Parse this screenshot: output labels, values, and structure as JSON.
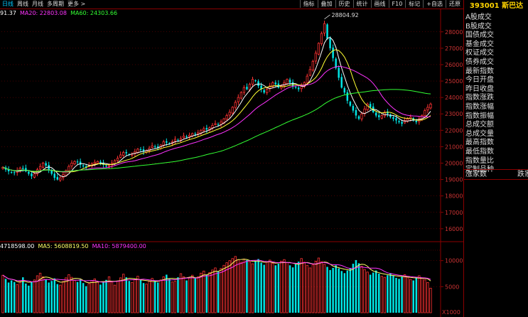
{
  "toolbar": {
    "tabs": [
      {
        "label": "日线",
        "active": true
      },
      {
        "label": "周线",
        "active": false
      },
      {
        "label": "月线",
        "active": false
      },
      {
        "label": "多周期",
        "active": false
      },
      {
        "label": "更多 >",
        "active": false
      }
    ],
    "buttons": [
      {
        "label": "指标",
        "icon": "indicator"
      },
      {
        "label": "叠加",
        "icon": "overlay"
      },
      {
        "label": "历史",
        "icon": "history"
      },
      {
        "label": "统计",
        "icon": "stats"
      },
      {
        "label": "画线",
        "icon": "draw-line"
      },
      {
        "label": "F10",
        "icon": "f10"
      },
      {
        "label": "标记",
        "icon": "mark"
      },
      {
        "label": "+自选",
        "icon": "add-watch"
      },
      {
        "label": "还原",
        "icon": "restore"
      }
    ]
  },
  "ma_legend": [
    {
      "text": "91.37",
      "color": "#ffffff"
    },
    {
      "text": "MA20: 22803.08",
      "color": "#ff33ff"
    },
    {
      "text": "MA60: 24303.66",
      "color": "#33ff33"
    }
  ],
  "volume_legend": [
    {
      "text": "4718598.00",
      "color": "#ffffff"
    },
    {
      "text": "MA5: 5608819.50",
      "color": "#ffff66"
    },
    {
      "text": "MA10: 5879400.00",
      "color": "#ff33ff"
    }
  ],
  "colors": {
    "up": "#ff3333",
    "down": "#00e5e5",
    "grid": "#8b0000",
    "axis_label": "#cc3333"
  },
  "right_panel": {
    "symbol": "393001 斯巴达",
    "menu": [
      "A股成交",
      "B股成交",
      "国债成交",
      "基金成交",
      "权证成交",
      "债券成交",
      "最新指数",
      "今日开盘",
      "昨日收盘",
      "指数涨跌",
      "指数涨幅",
      "指数振幅",
      "总成交额",
      "总成交量",
      "最高指数",
      "最低指数",
      "指数量比",
      "定制品种"
    ],
    "stats": [
      {
        "label": "涨家数"
      },
      {
        "label": "跌家"
      }
    ]
  },
  "chart_data": {
    "type": "candlestick",
    "price_axis": {
      "ticks": [
        28000,
        27000,
        26000,
        25000,
        24000,
        23000,
        22000,
        21000,
        20000,
        19000,
        18000,
        17000,
        16000
      ],
      "range": [
        15300,
        28900
      ]
    },
    "volume_axis": {
      "ticks": [
        10000,
        5000
      ],
      "unit_label": "X1000",
      "range": [
        0,
        12000
      ]
    },
    "peak_annotation": "28804.92",
    "closes": [
      19750,
      19600,
      19500,
      19450,
      19400,
      19550,
      19700,
      19650,
      19500,
      19350,
      19200,
      19350,
      19600,
      19800,
      20000,
      19850,
      19600,
      19350,
      19100,
      19000,
      19100,
      19300,
      19550,
      19800,
      20000,
      20100,
      20050,
      19900,
      19800,
      19750,
      19850,
      19950,
      20050,
      20100,
      20000,
      19900,
      19800,
      19850,
      20000,
      20150,
      20300,
      20500,
      20650,
      20600,
      20500,
      20550,
      20700,
      20850,
      20800,
      20700,
      20750,
      20900,
      21050,
      21000,
      20950,
      21100,
      21300,
      21250,
      21200,
      21300,
      21450,
      21400,
      21500,
      21650,
      21600,
      21700,
      21800,
      21750,
      21850,
      22000,
      22100,
      22050,
      22150,
      22300,
      22400,
      22350,
      22500,
      22700,
      22900,
      23100,
      23400,
      23700,
      24000,
      24300,
      24600,
      24500,
      24800,
      25100,
      25000,
      24700,
      24500,
      24300,
      24500,
      24700,
      24900,
      24800,
      24600,
      24700,
      24900,
      25100,
      24900,
      24700,
      24600,
      24500,
      24700,
      24900,
      25300,
      25700,
      26200,
      26700,
      27300,
      27900,
      28500,
      27600,
      27000,
      26400,
      25800,
      25200,
      24600,
      24300,
      23800,
      23500,
      23200,
      22900,
      22700,
      23000,
      23300,
      23600,
      23400,
      23100,
      22900,
      22800,
      22900,
      23100,
      23000,
      22800,
      22700,
      22600,
      22500,
      22400,
      22600,
      22700,
      22800,
      22600,
      22500,
      22700,
      22900,
      23200,
      23400,
      23600
    ],
    "volumes": [
      7200,
      6500,
      5800,
      6200,
      5900,
      5400,
      6100,
      6800,
      5600,
      5200,
      5900,
      6300,
      7100,
      7600,
      6900,
      6400,
      5800,
      6100,
      6600,
      5500,
      5300,
      6000,
      6700,
      7300,
      6800,
      6200,
      5900,
      6400,
      5700,
      5100,
      5600,
      6200,
      6500,
      6000,
      5400,
      5800,
      6300,
      6900,
      5900,
      5300,
      6100,
      6700,
      7400,
      6800,
      6100,
      5800,
      6400,
      7000,
      6300,
      5700,
      5500,
      6000,
      6600,
      6200,
      5800,
      6300,
      6900,
      7300,
      6500,
      5900,
      6100,
      6800,
      7500,
      6900,
      6200,
      6700,
      7200,
      6600,
      6900,
      7600,
      8000,
      7300,
      7700,
      8200,
      8600,
      7900,
      8500,
      9100,
      9600,
      10000,
      10400,
      10800,
      10200,
      9700,
      10300,
      10100,
      9800,
      9400,
      9900,
      10300,
      9600,
      9200,
      9700,
      10100,
      9500,
      9100,
      9400,
      9900,
      10200,
      9600,
      9100,
      8700,
      9300,
      9800,
      10400,
      9700,
      9100,
      8600,
      9200,
      9900,
      10500,
      9800,
      9300,
      8800,
      8200,
      8600,
      9100,
      8500,
      8000,
      7600,
      8100,
      8600,
      9400,
      10100,
      9500,
      8900,
      8300,
      7800,
      7300,
      7700,
      8100,
      7500,
      7000,
      6800,
      7200,
      7600,
      7100,
      6700,
      6500,
      6900,
      7300,
      6800,
      6400,
      6200,
      6700,
      7100,
      6600,
      6300,
      5800,
      4718
    ]
  }
}
